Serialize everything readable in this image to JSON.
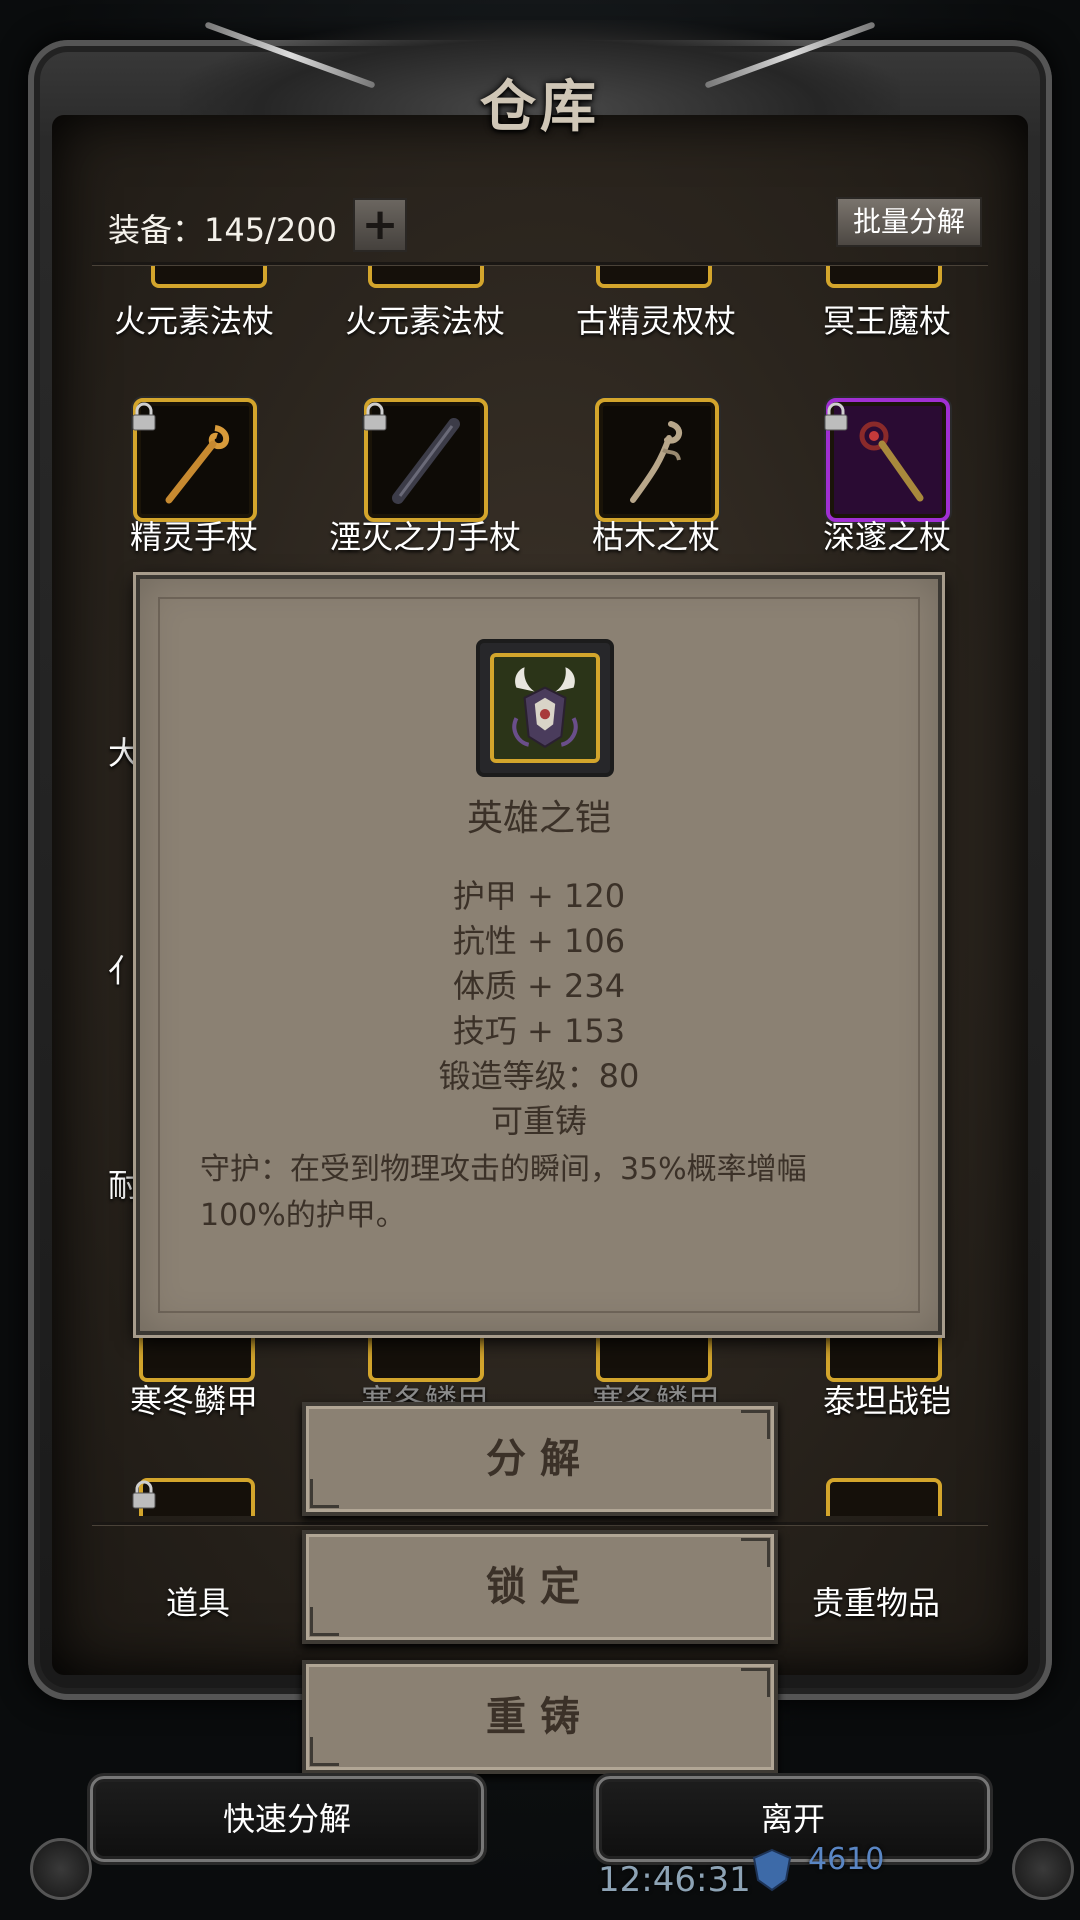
{
  "header": {
    "title": "仓库",
    "equip_count": "装备：145/200",
    "plus_label": "+",
    "bulk_decompose": "批量分解"
  },
  "grid": {
    "row1": [
      "火元素法杖",
      "火元素法杖",
      "古精灵权杖",
      "冥王魔杖"
    ],
    "row2": [
      "精灵手杖",
      "湮灭之力手杖",
      "枯木之杖",
      "深邃之杖"
    ],
    "row_hidden_left": [
      "大",
      "亻",
      "耐"
    ],
    "row5": [
      "寒冬鳞甲",
      "寒冬鳞甲",
      "寒冬鳞甲",
      "泰坦战铠"
    ]
  },
  "tooltip": {
    "name": "英雄之铠",
    "stats": [
      "护甲 + 120",
      "抗性 + 106",
      "体质 + 234",
      "技巧 + 153",
      "锻造等级：80",
      "可重铸"
    ],
    "description": "守护：在受到物理攻击的瞬间，35%概率增幅100%的护甲。"
  },
  "actions": {
    "decompose": "分解",
    "lock": "锁定",
    "recast": "重铸"
  },
  "tabs": {
    "props": "道具",
    "valuables": "贵重物品"
  },
  "footer": {
    "quick_decompose": "快速分解",
    "leave": "离开",
    "time": "12:46:31",
    "gems": "4610"
  },
  "colors": {
    "gold_frame": "#d3a52c",
    "purple_frame": "#a02fd2",
    "parchment": "#8b8173",
    "text_dark": "#3b3128"
  }
}
